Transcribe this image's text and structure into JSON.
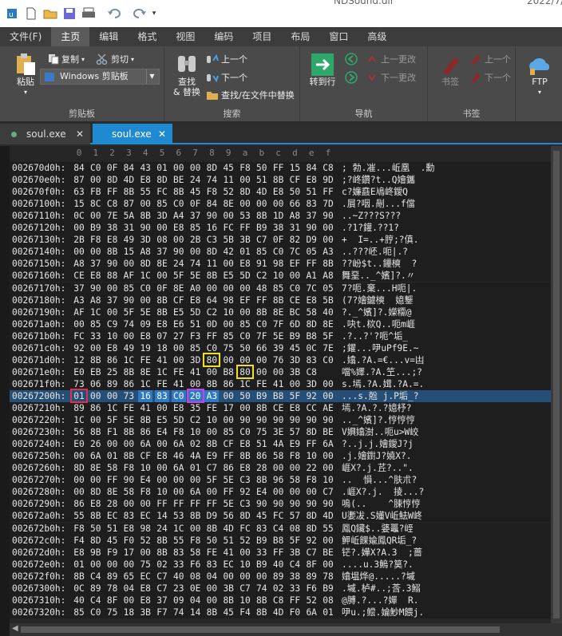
{
  "window": {
    "title_partial": "NDSound.dll",
    "date_partial": "2022/7/"
  },
  "menu": {
    "tabs": [
      "文件(F)",
      "主页",
      "编辑",
      "格式",
      "视图",
      "编码",
      "项目",
      "布局",
      "窗口",
      "高级"
    ],
    "active": "主页"
  },
  "ribbon": {
    "clipboard": {
      "label": "剪贴板",
      "paste": "粘贴",
      "copy": "复制",
      "cut": "剪切",
      "clipboard_select": "Windows 剪贴板"
    },
    "search": {
      "label": "搜索",
      "find_replace": "查找\n& 替换",
      "prev": "上一个",
      "next": "下一个",
      "find_in_files": "查找/在文件中替换"
    },
    "navigate": {
      "label": "导航",
      "goto": "转到行",
      "prev_change": "上一更改",
      "next_change": "下一更改"
    },
    "bookmarks": {
      "label": "书签",
      "bookmark": "书签",
      "prev": "上一个",
      "next": "下一个"
    },
    "ftp": {
      "label": "FTP"
    }
  },
  "doc_tabs": [
    {
      "name": "soul.exe",
      "active": false
    },
    {
      "name": "soul.exe",
      "active": true
    }
  ],
  "hex": {
    "col_headers": [
      "0",
      "1",
      "2",
      "3",
      "4",
      "5",
      "6",
      "7",
      "8",
      "9",
      "a",
      "b",
      "c",
      "d",
      "e",
      "f"
    ],
    "rows": [
      {
        "addr": "002670d0h:",
        "bytes": [
          "84",
          "C0",
          "0F",
          "84",
          "43",
          "01",
          "00",
          "00",
          "8D",
          "45",
          "F8",
          "50",
          "FF",
          "15",
          "84",
          "C8"
        ],
        "ascii": "; 勃.凗...岴凰  .勳"
      },
      {
        "addr": "002670e0h:",
        "bytes": [
          "87",
          "00",
          "8D",
          "4D",
          "E8",
          "8D",
          "BE",
          "24",
          "74",
          "11",
          "00",
          "51",
          "8B",
          "CF",
          "E8",
          "9D"
        ],
        "ascii": ";?峂鑽?t..Q嬒鑴"
      },
      {
        "addr": "002670f0h:",
        "bytes": [
          "63",
          "FB",
          "FF",
          "8B",
          "55",
          "FC",
          "8B",
          "45",
          "F8",
          "52",
          "8D",
          "4D",
          "E8",
          "50",
          "51",
          "FF"
        ],
        "ascii": "c?嬚鼖E鳰峂鑀Q"
      },
      {
        "addr": "00267100h:",
        "bytes": [
          "15",
          "8C",
          "C8",
          "87",
          "00",
          "85",
          "C0",
          "0F",
          "84",
          "8E",
          "00",
          "00",
          "00",
          "66",
          "83",
          "7D"
        ],
        "ascii": ".屓?咽.剮...f儅"
      },
      {
        "addr": "00267110h:",
        "bytes": [
          "0C",
          "00",
          "7E",
          "5A",
          "8B",
          "3D",
          "A4",
          "37",
          "90",
          "00",
          "53",
          "8B",
          "1D",
          "A8",
          "37",
          "90"
        ],
        "ascii": "..~Z???S???"
      },
      {
        "addr": "00267120h:",
        "bytes": [
          "00",
          "B9",
          "38",
          "31",
          "90",
          "00",
          "E8",
          "85",
          "16",
          "FC",
          "FF",
          "B9",
          "38",
          "31",
          "90",
          "00"
        ],
        "ascii": ".?1?鑵.??1?"
      },
      {
        "addr": "00267130h:",
        "bytes": [
          "2B",
          "F8",
          "E8",
          "49",
          "3D",
          "08",
          "00",
          "2B",
          "C3",
          "5B",
          "3B",
          "C7",
          "0F",
          "82",
          "D9",
          "00"
        ],
        "ascii": "+  I=..+脝;?傎."
      },
      {
        "addr": "00267140h:",
        "bytes": [
          "00",
          "00",
          "8B",
          "15",
          "A8",
          "37",
          "90",
          "00",
          "8D",
          "42",
          "01",
          "85",
          "C0",
          "7C",
          "05",
          "A3"
        ],
        "ascii": "..???岯.呃|.?"
      },
      {
        "addr": "00267150h:",
        "bytes": [
          "A8",
          "37",
          "90",
          "00",
          "8D",
          "8E",
          "24",
          "74",
          "11",
          "00",
          "E8",
          "91",
          "98",
          "EF",
          "FF",
          "8B"
        ],
        "ascii": "??岎$t..鑸樉  ?"
      },
      {
        "addr": "00267160h:",
        "bytes": [
          "CE",
          "E8",
          "88",
          "AF",
          "1C",
          "00",
          "5F",
          "5E",
          "8B",
          "E5",
          "5D",
          "C2",
          "10",
          "00",
          "A1",
          "A8"
        ],
        "ascii": "舞堊.._^嬪]?.〃"
      },
      {
        "addr": "00267170h:",
        "bytes": [
          "37",
          "90",
          "00",
          "85",
          "C0",
          "0F",
          "8E",
          "A0",
          "00",
          "00",
          "00",
          "48",
          "85",
          "C0",
          "7C",
          "05"
        ],
        "ascii": "7?呃.棄...H呃|."
      },
      {
        "addr": "00267180h:",
        "bytes": [
          "A3",
          "A8",
          "37",
          "90",
          "00",
          "8B",
          "CF",
          "E8",
          "64",
          "98",
          "EF",
          "FF",
          "8B",
          "CE",
          "E8",
          "5B"
        ],
        "ascii": "(7?嬒鑢樉  嬑鑋"
      },
      {
        "addr": "00267190h:",
        "bytes": [
          "AF",
          "1C",
          "00",
          "5F",
          "5E",
          "8B",
          "E5",
          "5D",
          "C2",
          "10",
          "00",
          "8B",
          "8E",
          "BC",
          "58",
          "40"
        ],
        "ascii": "?._^嬪]?.嬫糥@"
      },
      {
        "addr": "002671a0h:",
        "bytes": [
          "00",
          "85",
          "C9",
          "74",
          "09",
          "E8",
          "E6",
          "51",
          "0D",
          "00",
          "85",
          "C0",
          "7F",
          "6D",
          "8D",
          "8E"
        ],
        "ascii": ".吷t.栨Q..呃m崕"
      },
      {
        "addr": "002671b0h:",
        "bytes": [
          "FC",
          "33",
          "10",
          "00",
          "E8",
          "07",
          "27",
          "F3",
          "FF",
          "85",
          "C0",
          "7F",
          "5E",
          "B9",
          "B8",
          "5F"
        ],
        "ascii": ".?..?'?呃^垢_"
      },
      {
        "addr": "002671c0h:",
        "bytes": [
          "92",
          "00",
          "E8",
          "49",
          "19",
          "18",
          "00",
          "85",
          "C0",
          "75",
          "50",
          "66",
          "39",
          "45",
          "0C",
          "7E"
        ],
        "ascii": ";鑃...吚uPf9E.~"
      },
      {
        "addr": "002671d0h:",
        "bytes": [
          "12",
          "8B",
          "86",
          "1C",
          "FE",
          "41",
          "00",
          "3D",
          "80",
          "00",
          "00",
          "00",
          "76",
          "3D",
          "83",
          "C0"
        ],
        "ascii": ".嬆.?A.=€...v=凷"
      },
      {
        "addr": "002671e0h:",
        "bytes": [
          "E0",
          "EB",
          "25",
          "8B",
          "8E",
          "1C",
          "FE",
          "41",
          "00",
          "B8",
          "80",
          "00",
          "00",
          "3B",
          "C8"
        ],
        "ascii": "噹%嬕.?A.笁...;?"
      },
      {
        "addr": "002671f0h:",
        "bytes": [
          "73",
          "06",
          "89",
          "86",
          "1C",
          "FE",
          "41",
          "00",
          "8B",
          "86",
          "1C",
          "FE",
          "41",
          "00",
          "3D",
          "00"
        ],
        "ascii": "s.墕.?A.媶.?A.=."
      },
      {
        "addr": "00267200h:",
        "bytes": [
          "01",
          "00",
          "00",
          "73",
          "16",
          "83",
          "C0",
          "20",
          "A3",
          "00",
          "50",
          "B9",
          "B8",
          "5F",
          "92",
          "00"
        ],
        "ascii": "...s.兝 j.P垢_?"
      },
      {
        "addr": "00267210h:",
        "bytes": [
          "89",
          "86",
          "1C",
          "FE",
          "41",
          "00",
          "E8",
          "35",
          "FE",
          "17",
          "00",
          "8B",
          "CE",
          "E8",
          "CC",
          "AE"
        ],
        "ascii": "墕.?A.?.?嬑杼?"
      },
      {
        "addr": "00267220h:",
        "bytes": [
          "1C",
          "00",
          "5F",
          "5E",
          "8B",
          "E5",
          "5D",
          "C2",
          "10",
          "00",
          "90",
          "90",
          "90",
          "90",
          "90",
          "90"
        ],
        "ascii": ".._^嬪]?.悙悙悙"
      },
      {
        "addr": "00267230h:",
        "bytes": [
          "56",
          "8B",
          "F1",
          "8B",
          "86",
          "E4",
          "F8",
          "10",
          "00",
          "85",
          "C0",
          "75",
          "3E",
          "57",
          "8D",
          "BE"
        ],
        "ascii": "V嬹嬆澍..呃u>W峧"
      },
      {
        "addr": "00267240h:",
        "bytes": [
          "E0",
          "26",
          "00",
          "00",
          "6A",
          "00",
          "6A",
          "02",
          "8B",
          "CF",
          "E8",
          "51",
          "4A",
          "E9",
          "FF",
          "6A"
        ],
        "ascii": "?..j.j.嬒鑀J?j"
      },
      {
        "addr": "00267250h:",
        "bytes": [
          "00",
          "6A",
          "01",
          "8B",
          "CF",
          "E8",
          "46",
          "4A",
          "E9",
          "FF",
          "8B",
          "86",
          "58",
          "F8",
          "10",
          "00"
        ],
        "ascii": ".j.嬒鑆J?嬈X?."
      },
      {
        "addr": "00267260h:",
        "bytes": [
          "8D",
          "8E",
          "58",
          "F8",
          "10",
          "00",
          "6A",
          "01",
          "C7",
          "86",
          "E8",
          "28",
          "00",
          "00",
          "22",
          "00"
        ],
        "ascii": "崕X?.j.茊?..\"."
      },
      {
        "addr": "00267270h:",
        "bytes": [
          "00",
          "00",
          "FF",
          "90",
          "E4",
          "00",
          "00",
          "00",
          "5F",
          "5E",
          "C3",
          "8B",
          "96",
          "58",
          "F8",
          "10"
        ],
        "ascii": "..  愪...^肤朮?"
      },
      {
        "addr": "00267280h:",
        "bytes": [
          "00",
          "8D",
          "8E",
          "58",
          "F8",
          "10",
          "00",
          "6A",
          "00",
          "FF",
          "92",
          "E4",
          "00",
          "00",
          "00",
          "C7"
        ],
        "ascii": ".崕X?.j.  掕...?"
      },
      {
        "addr": "00267290h:",
        "bytes": [
          "86",
          "E8",
          "28",
          "00",
          "00",
          "FF",
          "FF",
          "FF",
          "FF",
          "5E",
          "C3",
          "90",
          "90",
          "90",
          "90",
          "90"
        ],
        "ascii": "嗚(..    ^脨悙悙"
      },
      {
        "addr": "002672a0h:",
        "bytes": [
          "55",
          "8B",
          "EC",
          "83",
          "EC",
          "14",
          "53",
          "8B",
          "D9",
          "56",
          "8D",
          "45",
          "FC",
          "57",
          "8D",
          "4D"
        ],
        "ascii": "U嬱冹.S嬞V岴魼W峂"
      },
      {
        "addr": "002672b0h:",
        "bytes": [
          "F8",
          "50",
          "51",
          "E8",
          "98",
          "24",
          "1C",
          "00",
          "8B",
          "4D",
          "FC",
          "83",
          "C4",
          "08",
          "8D",
          "55"
        ],
        "ascii": "鳳Q鑶$..婱鼉?峌"
      },
      {
        "addr": "002672c0h:",
        "bytes": [
          "F4",
          "8D",
          "45",
          "F0",
          "52",
          "8B",
          "55",
          "F8",
          "50",
          "51",
          "52",
          "B9",
          "B8",
          "5F",
          "92",
          "00"
        ],
        "ascii": "魻岴餜婾鳳QR垢_?"
      },
      {
        "addr": "002672d0h:",
        "bytes": [
          "E8",
          "9B",
          "F9",
          "17",
          "00",
          "8B",
          "83",
          "58",
          "FE",
          "41",
          "00",
          "33",
          "FF",
          "3B",
          "C7",
          "BE"
        ],
        "ascii": "铓?.嬅X?A.3  ;蔷"
      },
      {
        "addr": "002672e0h:",
        "bytes": [
          "01",
          "00",
          "00",
          "00",
          "75",
          "02",
          "33",
          "F6",
          "83",
          "EC",
          "10",
          "B9",
          "40",
          "C4",
          "8F",
          "00"
        ],
        "ascii": "....u.3鰞?筽?."
      },
      {
        "addr": "002672f0h:",
        "bytes": [
          "8B",
          "C4",
          "89",
          "65",
          "EC",
          "C7",
          "40",
          "08",
          "04",
          "00",
          "00",
          "00",
          "89",
          "38",
          "89",
          "78"
        ],
        "ascii": "嬆塭烨@.....?墄"
      },
      {
        "addr": "00267300h:",
        "bytes": [
          "0C",
          "89",
          "78",
          "04",
          "E8",
          "C7",
          "23",
          "0E",
          "00",
          "3B",
          "C7",
          "74",
          "02",
          "33",
          "F6",
          "B9"
        ],
        "ascii": ".墄.栌#..;莟.3鰯"
      },
      {
        "addr": "00267310h:",
        "bytes": [
          "40",
          "C4",
          "8F",
          "00",
          "E8",
          "37",
          "09",
          "04",
          "00",
          "8B",
          "10",
          "8B",
          "C8",
          "FF",
          "52",
          "08"
        ],
        "ascii": "@膊.?...?嬋  R."
      },
      {
        "addr": "00267320h:",
        "bytes": [
          "85",
          "C0",
          "75",
          "18",
          "3B",
          "F7",
          "74",
          "14",
          "8B",
          "45",
          "F4",
          "8B",
          "4D",
          "F0",
          "6A",
          "01"
        ],
        "ascii": "吚u.;鲿.婨魦M餵j."
      }
    ]
  },
  "annotations": {
    "box_red": "#e0304a",
    "box_yellow": "#f0e020",
    "box_magenta": "#d040e0"
  },
  "colors": {
    "accent": "#1f8ad2",
    "selection": "#264f78"
  }
}
